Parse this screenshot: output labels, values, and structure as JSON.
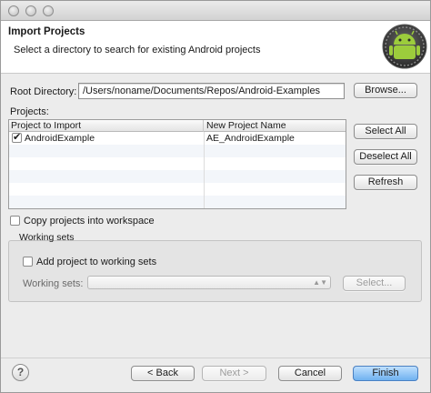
{
  "header": {
    "title": "Import Projects",
    "description": "Select a directory to search for existing Android projects",
    "logo_icon": "android-logo-icon"
  },
  "root_directory": {
    "label": "Root Directory:",
    "value": "/Users/noname/Documents/Repos/Android-Examples",
    "browse_label": "Browse..."
  },
  "projects": {
    "label": "Projects:",
    "columns": [
      "Project to Import",
      "New Project Name"
    ],
    "rows": [
      {
        "checked": true,
        "project": "AndroidExample",
        "new_name": "AE_AndroidExample"
      }
    ],
    "select_all_label": "Select All",
    "deselect_all_label": "Deselect All",
    "refresh_label": "Refresh"
  },
  "copy_into_workspace": {
    "label": "Copy projects into workspace",
    "checked": false
  },
  "working_sets": {
    "group_title": "Working sets",
    "add_label": "Add project to working sets",
    "add_checked": false,
    "field_label": "Working sets:",
    "select_label": "Select..."
  },
  "footer": {
    "help_icon": "help-icon",
    "help_glyph": "?",
    "back_label": "< Back",
    "next_label": "Next >",
    "cancel_label": "Cancel",
    "finish_label": "Finish"
  }
}
